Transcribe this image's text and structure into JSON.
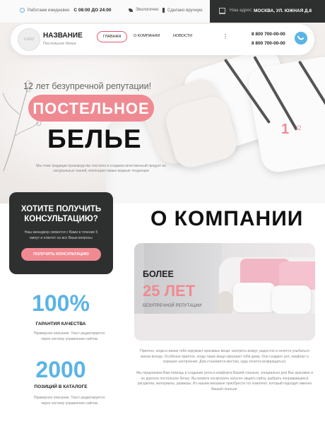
{
  "topbar": {
    "hours_label": "Работаем ежедневно",
    "hours_value": "С 08:00 ДО 24:00",
    "eco_label": "Экологично",
    "quality_label": "Сделано вручную",
    "address_label": "Наш адрес:",
    "address_value": "МОСКВА, УЛ. ЮЖНАЯ Д.8"
  },
  "header": {
    "logo_text": "LOGO",
    "brand": "НАЗВАНИЕ",
    "tagline": "Постельное белье",
    "menu": [
      "ГЛАВНАЯ",
      "О КОМПАНИИ",
      "НОВОСТИ"
    ],
    "more_icon": "more-icon",
    "phones": [
      "8 800 700-00-00",
      "8 800 700-00-00"
    ],
    "call_icon": "phone-icon"
  },
  "hero": {
    "reputation": "12 лет безупречной репутации!",
    "title_pill": "ПОСТЕЛЬНОЕ",
    "title_big": "БЕЛЬЕ",
    "description": "Мы чтим традиции производства текстиля и создаем качественный продукт из натуральных тканей, воплощая самые модные тенденции",
    "slide_current": "1",
    "slide_total": "/2"
  },
  "consult": {
    "title": "ХОТИТЕ ПОЛУЧИТЬ КОНСУЛЬТАЦИЮ?",
    "description": "Наш менеджер свяжется с Вами в течение 5 минут и ответит на все Ваши вопросы",
    "button": "ПОЛУЧИТЬ КОНСУЛЬТАЦИЮ"
  },
  "about": {
    "title": "О КОМПАНИИ",
    "image_line1": "БОЛЕЕ",
    "image_line2": "25 ЛЕТ",
    "image_line3": "БЕЗУПРЕЧНОЙ РЕПУТАЦИИ",
    "text1": "Приятно, когда в жизни тебя окружают красивые вещи: смотреть вокруг, радостно и хочется улыбаться жизни всегда. Особенно приятно, когда такие вещи окружают тебя дома. Они создают уют, комфорт и хорошее настроение. Дом становится местом, куда хочется возвращаться.",
    "text2": "Мы предлагаем Вам помощь в создании уюта и комфорта Вашей спальни, специально для Вас красивое и не дорогое постельное белье. Вы можете посмотреть каталог нашего сайта, выбрать понравившиеся расцветки, материалы, размеры. Из нашем магазине приобрести тот комплект, который подходит именно Вашей спальне."
  },
  "stats": [
    {
      "value": "100%",
      "label": "ГАРАНТИЯ КАЧЕСТВА",
      "description": "Примерное описание. Текст редактируется через систему управления сайтом"
    },
    {
      "value": "2000",
      "label": "ПОЗИЦИЙ В КАТАЛОГЕ",
      "description": "Примерное описание. Текст редактируется через систему управления сайтом"
    }
  ],
  "colors": {
    "accent_pink": "#f08a92",
    "accent_blue": "#5ab4e6",
    "dark": "#2e3030"
  }
}
